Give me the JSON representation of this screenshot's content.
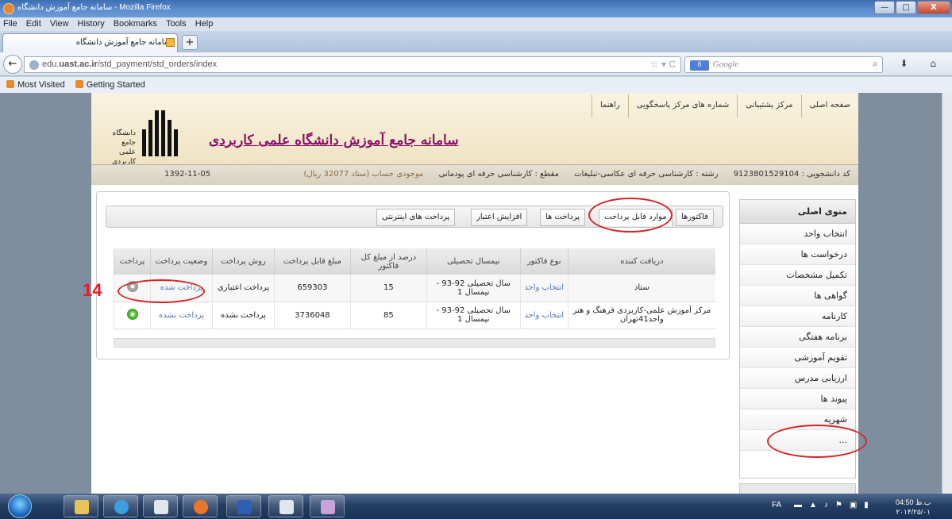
{
  "window": {
    "title": "سامانه جامع آموزش دانشگاه - Mozilla Firefox",
    "btn_min": "—",
    "btn_max": "□",
    "btn_close": "X"
  },
  "menu": [
    "File",
    "Edit",
    "View",
    "History",
    "Bookmarks",
    "Tools",
    "Help"
  ],
  "tab": {
    "label": "سامانه جامع آموزش دانشگاه",
    "new_tab": "+"
  },
  "nav": {
    "back": "←",
    "url_host": "edu.uast.ac.ir",
    "url_path": "/std_payment/std_orders/index",
    "url_prefix": "edu.",
    "url_bold": "uast.ac.ir",
    "search_placeholder": "Google",
    "search_engine": "8",
    "icons": "⌕ ⬇ ⌂"
  },
  "bookmarks": [
    "Most Visited",
    "Getting Started"
  ],
  "site": {
    "topnav": [
      "صفحه اصلی",
      "مرکز پشتیبانی",
      "شماره های مرکز پاسخگویی",
      "راهنما"
    ],
    "title": "سامانه جامع آموزش دانشگاه علمی کاربردی",
    "logo_text": "دانشگاه جامع علمی کاربردی",
    "info": {
      "student_code": "کد دانشجویی : 9123801529104",
      "major": "رشته : کارشناسی حرفه ای عکاسی-تبلیغات",
      "level": "مقطع : کارشناسی حرفه ای پودمانی",
      "balance": "موجودی حساب (ستاد 32077 ریال)",
      "date": "1392-11-05"
    }
  },
  "sidemenu": {
    "header": "منوی اصلی",
    "items": [
      "انتخاب واحد",
      "درخواست ها",
      "تکمیل مشخصات",
      "گواهی ها",
      "کارنامه",
      "برنامه هفتگی",
      "تقویم آموزشی",
      "ارزیابی مدرس",
      "پیوند ها",
      "شهریه",
      "..."
    ]
  },
  "content_tabs": [
    "فاکتورها",
    "موارد قابل پرداخت",
    "پرداخت ها",
    "افزایش اعتبار",
    "پرداخت های اینترنتی"
  ],
  "table": {
    "headers": [
      "دریافت کننده",
      "نوع فاکتور",
      "نیمسال تحصیلی",
      "درصد از مبلغ کل فاکتور",
      "مبلغ قابل پرداخت",
      "روش پرداخت",
      "وضعیت پرداخت",
      "پرداخت"
    ],
    "rows": [
      {
        "receiver": "ستاد",
        "type": "انتخاب واحد",
        "term": "سال تحصیلی 92-93 - نیمسال 1",
        "percent": "15",
        "amount": "659303",
        "method": "پرداخت اعتباری",
        "status": "پرداخت شده"
      },
      {
        "receiver": "مرکز آموزش علمی-کاربردی فرهنگ و هنر واحد41تهران",
        "type": "انتخاب واحد",
        "term": "سال تحصیلی 92-93 - نیمسال 1",
        "percent": "85",
        "amount": "3736048",
        "method": "پرداخت نشده",
        "status": "پرداخت نشده"
      }
    ]
  },
  "annotation_number": "14",
  "taskbar": {
    "lang": "FA",
    "time": "04:50 ب.ظ",
    "date": "۲۰۱۴/۲۵/۰۱"
  },
  "colors": {
    "title_accent": "#8a0f6a",
    "link": "#4f78b6",
    "annotation": "#d32727"
  }
}
